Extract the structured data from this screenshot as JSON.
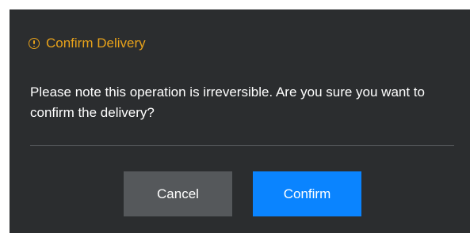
{
  "dialog": {
    "title": "Confirm Delivery",
    "title_icon": "warning-circle-icon",
    "message": "Please note this operation is irreversible. Are you sure you want to confirm the delivery?",
    "cancel_label": "Cancel",
    "confirm_label": "Confirm"
  },
  "colors": {
    "dialog_background": "#2b2d2f",
    "title_accent": "#e8a21a",
    "cancel_button": "#55585b",
    "confirm_button": "#0a84ff",
    "divider": "#5c5f63"
  }
}
